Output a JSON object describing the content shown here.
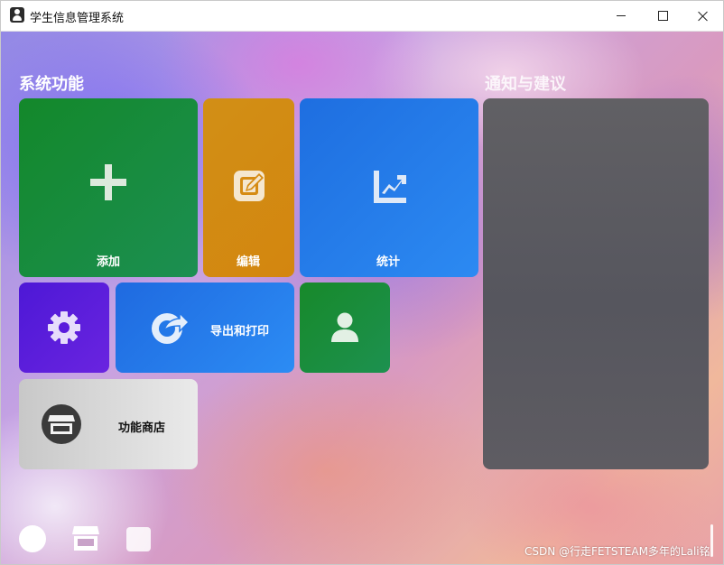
{
  "window": {
    "title": "学生信息管理系统",
    "controls": {
      "minimize": "minimize",
      "maximize": "maximize",
      "close": "close"
    }
  },
  "sections": {
    "functions_title": "系统功能",
    "notice_title": "通知与建议"
  },
  "tiles": {
    "add": {
      "label": "添加",
      "icon": "plus-icon",
      "color": "#13882a"
    },
    "edit": {
      "label": "编辑",
      "icon": "edit-icon",
      "color": "#d28f16"
    },
    "stats": {
      "label": "统计",
      "icon": "chart-icon",
      "color": "#1e6ee0"
    },
    "settings": {
      "icon": "gear-icon",
      "color": "#5a1cdc"
    },
    "export": {
      "label": "导出和打印",
      "icon": "share-icon",
      "color": "#2378e8"
    },
    "user": {
      "icon": "user-icon",
      "color": "#17892a"
    },
    "store": {
      "label": "功能商店",
      "icon": "store-icon",
      "color": "#d9d9d9"
    }
  },
  "bottom_bar": {
    "icons": [
      "circle-icon",
      "store-icon",
      "square-icon"
    ]
  },
  "watermark": "CSDN @行走FETSTEAM多年的Lali铭"
}
